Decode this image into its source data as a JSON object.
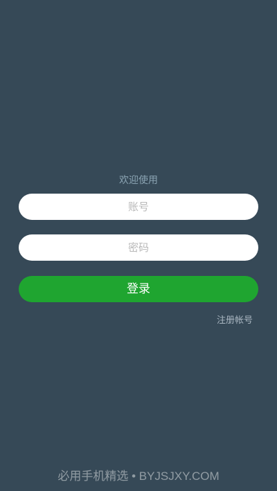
{
  "login": {
    "welcome_text": "欢迎使用",
    "account_placeholder": "账号",
    "password_placeholder": "密码",
    "login_button_label": "登录",
    "register_link_label": "注册帐号"
  },
  "watermark": {
    "text": "必用手机精选 • BYJSJXY.COM"
  },
  "colors": {
    "background": "#364957",
    "accent": "#1fa530",
    "field_background": "#ffffff"
  }
}
